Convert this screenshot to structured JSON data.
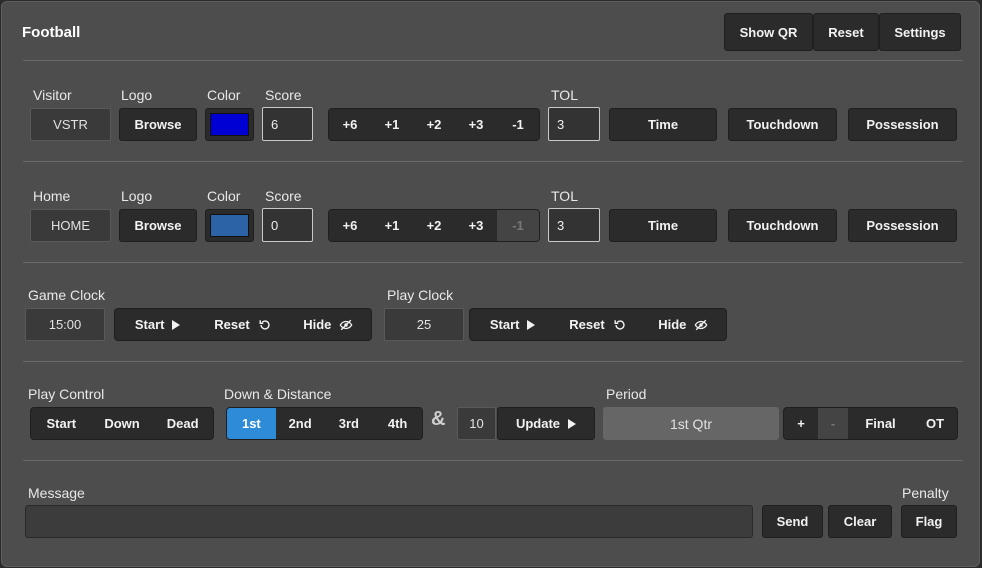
{
  "app": {
    "title": "Football"
  },
  "header": {
    "show_qr": "Show QR",
    "reset": "Reset",
    "settings": "Settings"
  },
  "labels": {
    "logo": "Logo",
    "color": "Color",
    "score": "Score",
    "tol": "TOL"
  },
  "visitor": {
    "label": "Visitor",
    "name": "VSTR",
    "browse": "Browse",
    "color": "#0000d4",
    "score": "6",
    "score_buttons": [
      "+6",
      "+1",
      "+2",
      "+3",
      "-1"
    ],
    "tol": "3",
    "time": "Time",
    "touchdown": "Touchdown",
    "possession": "Possession"
  },
  "home": {
    "label": "Home",
    "name": "HOME",
    "browse": "Browse",
    "color": "#2c63a6",
    "score": "0",
    "score_buttons": [
      "+6",
      "+1",
      "+2",
      "+3",
      "-1"
    ],
    "tol": "3",
    "time": "Time",
    "touchdown": "Touchdown",
    "possession": "Possession"
  },
  "game_clock": {
    "label": "Game Clock",
    "value": "15:00",
    "start": "Start",
    "reset": "Reset",
    "hide": "Hide"
  },
  "play_clock": {
    "label": "Play Clock",
    "value": "25",
    "start": "Start",
    "reset": "Reset",
    "hide": "Hide"
  },
  "play_control": {
    "label": "Play Control",
    "buttons": [
      "Start",
      "Down",
      "Dead"
    ]
  },
  "down_distance": {
    "label": "Down & Distance",
    "downs": [
      "1st",
      "2nd",
      "3rd",
      "4th"
    ],
    "active": "1st",
    "amp": "&",
    "distance": "10",
    "update": "Update"
  },
  "period": {
    "label": "Period",
    "value": "1st Qtr",
    "plus": "+",
    "minus": "-",
    "final": "Final",
    "ot": "OT"
  },
  "message": {
    "label": "Message",
    "value": "",
    "send": "Send",
    "clear": "Clear"
  },
  "penalty": {
    "label": "Penalty",
    "flag": "Flag"
  }
}
